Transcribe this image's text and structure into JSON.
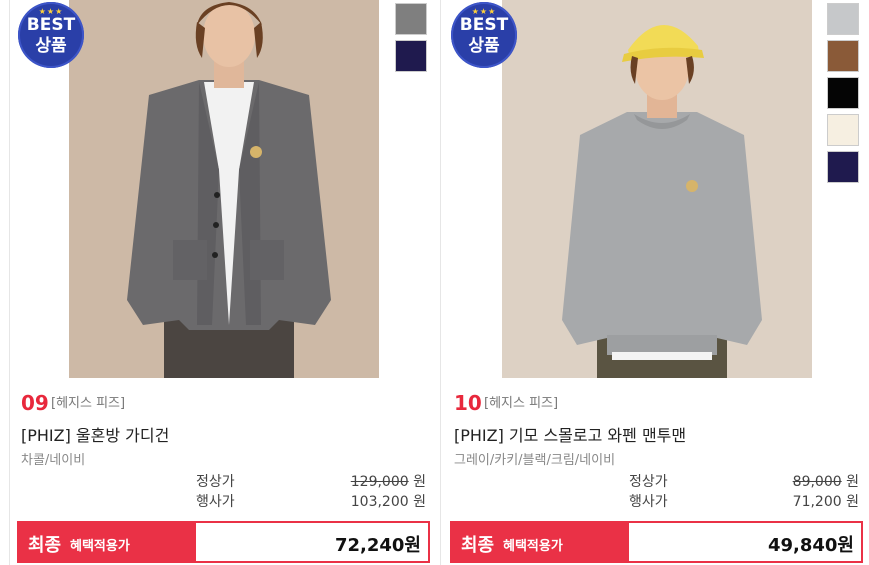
{
  "products": [
    {
      "rank": "09",
      "brand": "[헤지스 피즈]",
      "name": "[PHIZ] 울혼방 가디건",
      "colors": "차콜/네이비",
      "badge": {
        "stars": "★★★",
        "top": "BEST",
        "bottom": "상품"
      },
      "swatch_colors": [
        "#7f7f7f",
        "#1f1a4e"
      ],
      "regular_label": "정상가",
      "regular_price": "129,000",
      "sale_label": "행사가",
      "sale_price": "103,200",
      "currency": "원",
      "final_title": "최종",
      "final_sub": "혜택적용가",
      "final_price": "72,240원"
    },
    {
      "rank": "10",
      "brand": "[헤지스 피즈]",
      "name": "[PHIZ] 기모 스몰로고 와펜 맨투맨",
      "colors": "그레이/카키/블랙/크림/네이비",
      "badge": {
        "stars": "★★★",
        "top": "BEST",
        "bottom": "상품"
      },
      "swatch_colors": [
        "#c6c8ca",
        "#8a5a38",
        "#050505",
        "#f6efe1",
        "#1f1a4e"
      ],
      "regular_label": "정상가",
      "regular_price": "89,000",
      "sale_label": "행사가",
      "sale_price": "71,200",
      "currency": "원",
      "final_title": "최종",
      "final_sub": "혜택적용가",
      "final_price": "49,840원"
    }
  ],
  "colors": {
    "accent": "#ea3146",
    "badge": "#2a3fa8",
    "rank": "#e8283c"
  }
}
